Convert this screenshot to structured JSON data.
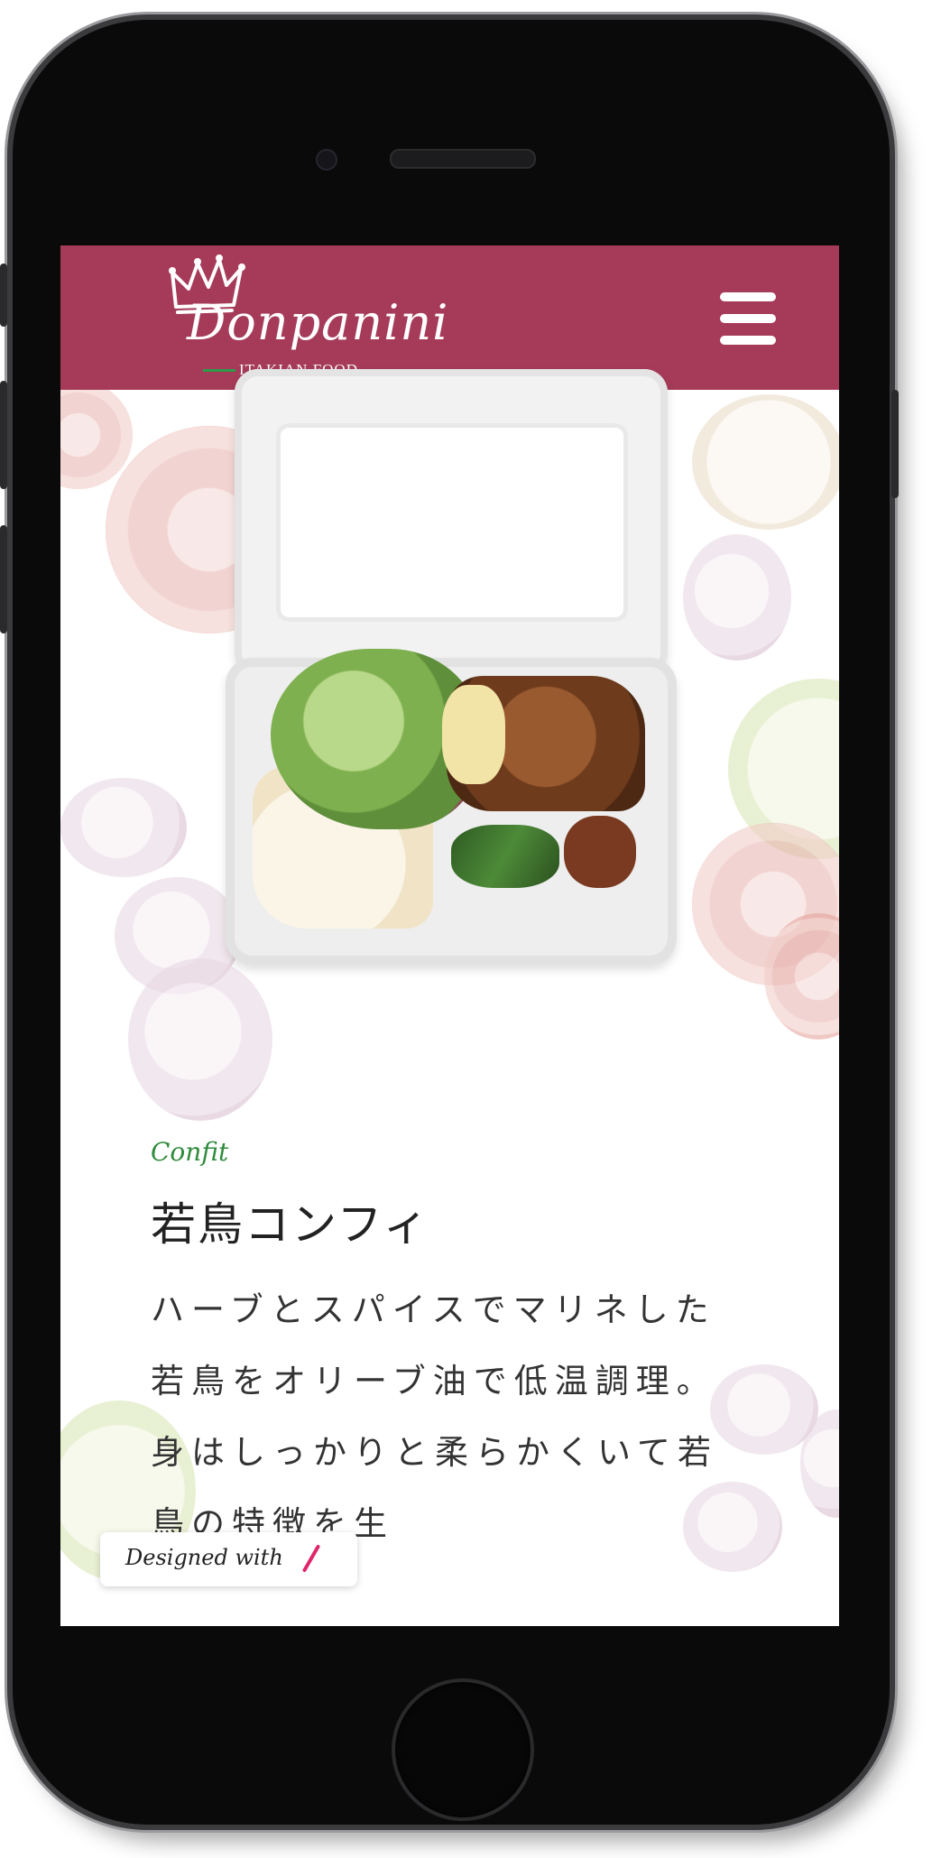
{
  "header": {
    "brand_name": "Donpanini",
    "brand_tagline": "ITAKIAN FOOD",
    "background_color": "#a63b59",
    "menu_icon": "hamburger-menu-icon",
    "logo_icon": "crown-fork-icon"
  },
  "hero": {
    "image_subject": "bento-box-photo"
  },
  "menu_item": {
    "subtitle": "Confit",
    "title": "若鳥コンフィ",
    "description": "ハーブとスパイスでマリネした若鳥をオリーブ油で低温調理。身はしっかりと柔らかくいて若鳥の特徴を生",
    "subtitle_color": "#2e8b3c"
  },
  "footer_badge": {
    "label": "Designed with",
    "icon": "slash-logo-icon",
    "accent_color": "#e0266b"
  }
}
